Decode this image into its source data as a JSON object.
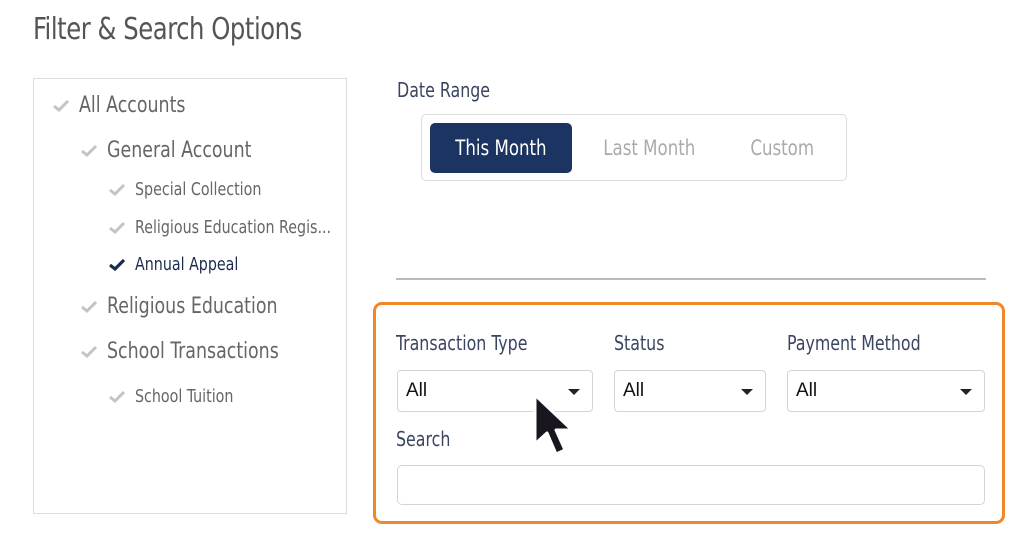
{
  "page": {
    "title": "Filter & Search Options"
  },
  "account_tree": {
    "items": [
      {
        "label": "All Accounts",
        "level": 0,
        "checked": false
      },
      {
        "label": "General Account",
        "level": 1,
        "checked": false
      },
      {
        "label": "Special Collection",
        "level": 2,
        "checked": false
      },
      {
        "label": "Religious Education Regis...",
        "level": 2,
        "checked": false
      },
      {
        "label": "Annual Appeal",
        "level": 2,
        "checked": true
      },
      {
        "label": "Religious Education",
        "level": 1,
        "checked": false
      },
      {
        "label": "School Transactions",
        "level": 1,
        "checked": false
      },
      {
        "label": "School Tuition",
        "level": 2,
        "checked": false
      }
    ],
    "check_icon": "checkmark-icon",
    "colors": {
      "unchecked": "#c4c4c4",
      "checked": "#1c2c4f"
    }
  },
  "date_range": {
    "label": "Date Range",
    "options": [
      {
        "label": "This Month",
        "active": true
      },
      {
        "label": "Last Month",
        "active": false
      },
      {
        "label": "Custom",
        "active": false
      }
    ],
    "active_color": "#1b3461"
  },
  "filters": {
    "highlight_color": "#f0872a",
    "transaction_type": {
      "label": "Transaction Type",
      "value": "All"
    },
    "status": {
      "label": "Status",
      "value": "All"
    },
    "payment_method": {
      "label": "Payment Method",
      "value": "All"
    },
    "search": {
      "label": "Search",
      "value": "",
      "placeholder": ""
    }
  },
  "cursor": {
    "icon": "mouse-pointer-icon"
  }
}
